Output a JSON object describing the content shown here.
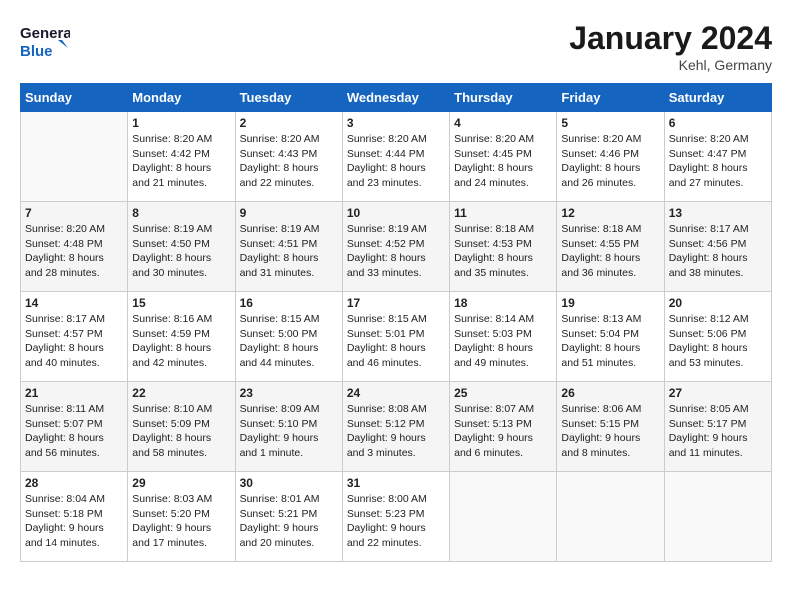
{
  "header": {
    "logo_general": "General",
    "logo_blue": "Blue",
    "month": "January 2024",
    "location": "Kehl, Germany"
  },
  "weekdays": [
    "Sunday",
    "Monday",
    "Tuesday",
    "Wednesday",
    "Thursday",
    "Friday",
    "Saturday"
  ],
  "weeks": [
    [
      {
        "day": "",
        "info": ""
      },
      {
        "day": "1",
        "info": "Sunrise: 8:20 AM\nSunset: 4:42 PM\nDaylight: 8 hours\nand 21 minutes."
      },
      {
        "day": "2",
        "info": "Sunrise: 8:20 AM\nSunset: 4:43 PM\nDaylight: 8 hours\nand 22 minutes."
      },
      {
        "day": "3",
        "info": "Sunrise: 8:20 AM\nSunset: 4:44 PM\nDaylight: 8 hours\nand 23 minutes."
      },
      {
        "day": "4",
        "info": "Sunrise: 8:20 AM\nSunset: 4:45 PM\nDaylight: 8 hours\nand 24 minutes."
      },
      {
        "day": "5",
        "info": "Sunrise: 8:20 AM\nSunset: 4:46 PM\nDaylight: 8 hours\nand 26 minutes."
      },
      {
        "day": "6",
        "info": "Sunrise: 8:20 AM\nSunset: 4:47 PM\nDaylight: 8 hours\nand 27 minutes."
      }
    ],
    [
      {
        "day": "7",
        "info": "Sunrise: 8:20 AM\nSunset: 4:48 PM\nDaylight: 8 hours\nand 28 minutes."
      },
      {
        "day": "8",
        "info": "Sunrise: 8:19 AM\nSunset: 4:50 PM\nDaylight: 8 hours\nand 30 minutes."
      },
      {
        "day": "9",
        "info": "Sunrise: 8:19 AM\nSunset: 4:51 PM\nDaylight: 8 hours\nand 31 minutes."
      },
      {
        "day": "10",
        "info": "Sunrise: 8:19 AM\nSunset: 4:52 PM\nDaylight: 8 hours\nand 33 minutes."
      },
      {
        "day": "11",
        "info": "Sunrise: 8:18 AM\nSunset: 4:53 PM\nDaylight: 8 hours\nand 35 minutes."
      },
      {
        "day": "12",
        "info": "Sunrise: 8:18 AM\nSunset: 4:55 PM\nDaylight: 8 hours\nand 36 minutes."
      },
      {
        "day": "13",
        "info": "Sunrise: 8:17 AM\nSunset: 4:56 PM\nDaylight: 8 hours\nand 38 minutes."
      }
    ],
    [
      {
        "day": "14",
        "info": "Sunrise: 8:17 AM\nSunset: 4:57 PM\nDaylight: 8 hours\nand 40 minutes."
      },
      {
        "day": "15",
        "info": "Sunrise: 8:16 AM\nSunset: 4:59 PM\nDaylight: 8 hours\nand 42 minutes."
      },
      {
        "day": "16",
        "info": "Sunrise: 8:15 AM\nSunset: 5:00 PM\nDaylight: 8 hours\nand 44 minutes."
      },
      {
        "day": "17",
        "info": "Sunrise: 8:15 AM\nSunset: 5:01 PM\nDaylight: 8 hours\nand 46 minutes."
      },
      {
        "day": "18",
        "info": "Sunrise: 8:14 AM\nSunset: 5:03 PM\nDaylight: 8 hours\nand 49 minutes."
      },
      {
        "day": "19",
        "info": "Sunrise: 8:13 AM\nSunset: 5:04 PM\nDaylight: 8 hours\nand 51 minutes."
      },
      {
        "day": "20",
        "info": "Sunrise: 8:12 AM\nSunset: 5:06 PM\nDaylight: 8 hours\nand 53 minutes."
      }
    ],
    [
      {
        "day": "21",
        "info": "Sunrise: 8:11 AM\nSunset: 5:07 PM\nDaylight: 8 hours\nand 56 minutes."
      },
      {
        "day": "22",
        "info": "Sunrise: 8:10 AM\nSunset: 5:09 PM\nDaylight: 8 hours\nand 58 minutes."
      },
      {
        "day": "23",
        "info": "Sunrise: 8:09 AM\nSunset: 5:10 PM\nDaylight: 9 hours\nand 1 minute."
      },
      {
        "day": "24",
        "info": "Sunrise: 8:08 AM\nSunset: 5:12 PM\nDaylight: 9 hours\nand 3 minutes."
      },
      {
        "day": "25",
        "info": "Sunrise: 8:07 AM\nSunset: 5:13 PM\nDaylight: 9 hours\nand 6 minutes."
      },
      {
        "day": "26",
        "info": "Sunrise: 8:06 AM\nSunset: 5:15 PM\nDaylight: 9 hours\nand 8 minutes."
      },
      {
        "day": "27",
        "info": "Sunrise: 8:05 AM\nSunset: 5:17 PM\nDaylight: 9 hours\nand 11 minutes."
      }
    ],
    [
      {
        "day": "28",
        "info": "Sunrise: 8:04 AM\nSunset: 5:18 PM\nDaylight: 9 hours\nand 14 minutes."
      },
      {
        "day": "29",
        "info": "Sunrise: 8:03 AM\nSunset: 5:20 PM\nDaylight: 9 hours\nand 17 minutes."
      },
      {
        "day": "30",
        "info": "Sunrise: 8:01 AM\nSunset: 5:21 PM\nDaylight: 9 hours\nand 20 minutes."
      },
      {
        "day": "31",
        "info": "Sunrise: 8:00 AM\nSunset: 5:23 PM\nDaylight: 9 hours\nand 22 minutes."
      },
      {
        "day": "",
        "info": ""
      },
      {
        "day": "",
        "info": ""
      },
      {
        "day": "",
        "info": ""
      }
    ]
  ]
}
